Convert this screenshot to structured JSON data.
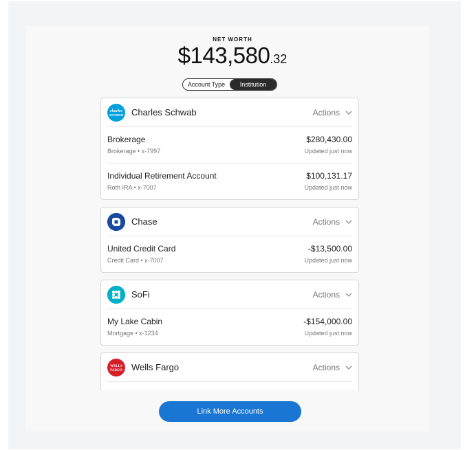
{
  "net_worth": {
    "label": "NET WORTH",
    "dollars": "$143,580",
    "cents": ".32"
  },
  "toggle": {
    "options": [
      "Account Type",
      "Institution"
    ],
    "selected": "Institution"
  },
  "institutions": [
    {
      "name": "Charles Schwab",
      "logo_text": "charles SCHWAB",
      "logo_color": "#00a0df",
      "actions_label": "Actions",
      "accounts": [
        {
          "name": "Brokerage",
          "sub": "Brokerage • x-7997",
          "amount": "$280,430.00",
          "updated": "Updated just now"
        },
        {
          "name": "Individual Retirement Account",
          "sub": "Roth IRA • x-7007",
          "amount": "$100,131.17",
          "updated": "Updated just now"
        }
      ]
    },
    {
      "name": "Chase",
      "logo_color": "#1a4aa0",
      "actions_label": "Actions",
      "accounts": [
        {
          "name": "United Credit Card",
          "sub": "Credit Card • x-7007",
          "amount": "-$13,500.00",
          "updated": "Updated just now"
        }
      ]
    },
    {
      "name": "SoFi",
      "logo_color": "#00b0c8",
      "actions_label": "Actions",
      "accounts": [
        {
          "name": "My Lake Cabin",
          "sub": "Mortgage • x-1234",
          "amount": "-$154,000.00",
          "updated": "Updated just now"
        }
      ]
    },
    {
      "name": "Wells Fargo",
      "logo_text": "WELLS FARGO",
      "logo_color": "#d71e28",
      "actions_label": "Actions",
      "accounts": []
    }
  ],
  "link_button": "Link More Accounts"
}
